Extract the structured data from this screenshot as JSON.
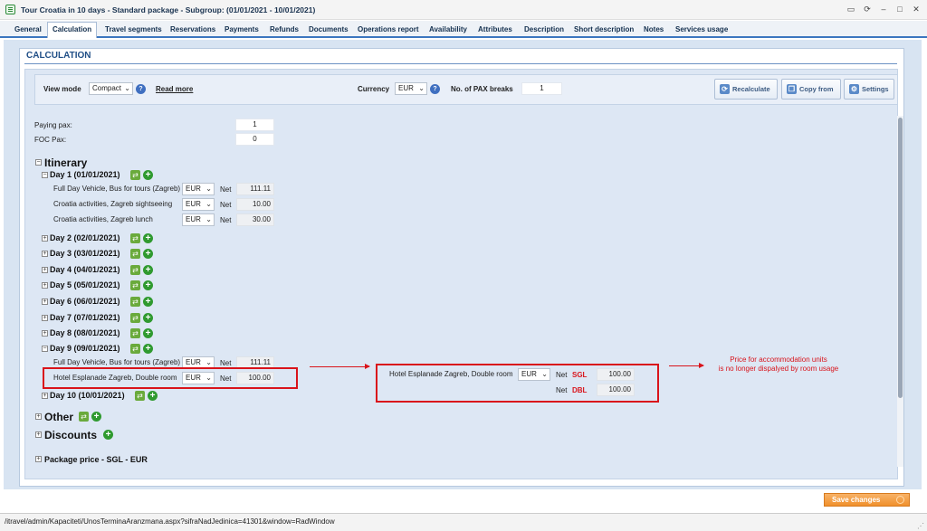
{
  "window": {
    "title": "Tour Croatia in 10 days - Standard package - Subgroup: (01/01/2021 - 10/01/2021)"
  },
  "tabs": [
    {
      "label": "General"
    },
    {
      "label": "Calculation",
      "active": true
    },
    {
      "label": "Travel segments"
    },
    {
      "label": "Reservations"
    },
    {
      "label": "Payments"
    },
    {
      "label": "Refunds"
    },
    {
      "label": "Documents"
    },
    {
      "label": "Operations report"
    },
    {
      "label": "Availability"
    },
    {
      "label": "Attributes"
    },
    {
      "label": "Description"
    },
    {
      "label": "Short description"
    },
    {
      "label": "Notes"
    },
    {
      "label": "Services usage"
    }
  ],
  "section": {
    "title": "CALCULATION"
  },
  "toolbar": {
    "view_mode_label": "View mode",
    "view_mode_value": "Compact",
    "read_more": "Read more",
    "currency_label": "Currency",
    "currency_value": "EUR",
    "pax_breaks_label": "No. of PAX breaks",
    "pax_breaks_value": "1",
    "recalculate": "Recalculate",
    "copy_from": "Copy from",
    "settings": "Settings"
  },
  "pax": {
    "paying_label": "Paying pax:",
    "paying_value": "1",
    "foc_label": "FOC Pax:",
    "foc_value": "0"
  },
  "itinerary": {
    "title": "Itinerary",
    "days": [
      {
        "label": "Day 1 (01/01/2021)"
      },
      {
        "label": "Day 2 (02/01/2021)"
      },
      {
        "label": "Day 3 (03/01/2021)"
      },
      {
        "label": "Day 4 (04/01/2021)"
      },
      {
        "label": "Day 5 (05/01/2021)"
      },
      {
        "label": "Day 6 (06/01/2021)"
      },
      {
        "label": "Day 7 (07/01/2021)"
      },
      {
        "label": "Day 8 (08/01/2021)"
      },
      {
        "label": "Day 9 (09/01/2021)"
      },
      {
        "label": "Day 10 (10/01/2021)"
      }
    ],
    "day1_services": [
      {
        "name": "Full Day Vehicle, Bus for tours (Zagreb)",
        "currency": "EUR",
        "net_label": "Net",
        "value": "111.11"
      },
      {
        "name": "Croatia activities, Zagreb sightseeing",
        "currency": "EUR",
        "net_label": "Net",
        "value": "10.00"
      },
      {
        "name": "Croatia activities, Zagreb lunch",
        "currency": "EUR",
        "net_label": "Net",
        "value": "30.00"
      }
    ],
    "day9_services": [
      {
        "name": "Full Day Vehicle, Bus for tours (Zagreb)",
        "currency": "EUR",
        "net_label": "Net",
        "value": "111.11"
      },
      {
        "name": "Hotel Esplanade Zagreb, Double room",
        "currency": "EUR",
        "net_label": "Net",
        "value": "100.00"
      }
    ]
  },
  "comparison": {
    "name": "Hotel Esplanade Zagreb, Double room",
    "currency": "EUR",
    "rows": [
      {
        "net_label": "Net",
        "room": "SGL",
        "value": "100.00"
      },
      {
        "net_label": "Net",
        "room": "DBL",
        "value": "100.00"
      }
    ],
    "note_line1": "Price for accommodation units",
    "note_line2": "is no longer dispalyed by room usage"
  },
  "other": {
    "title": "Other"
  },
  "discounts": {
    "title": "Discounts"
  },
  "package_price": {
    "title": "Package price - SGL - EUR"
  },
  "save_changes": "Save changes",
  "status_url": "/itravel/admin/Kapaciteti/UnosTerminaAranzmana.aspx?sifraNadJedinica=41301&window=RadWindow",
  "colors": {
    "accent": "#3b76bf",
    "annotation": "#d9141b",
    "save": "#f0902c"
  }
}
